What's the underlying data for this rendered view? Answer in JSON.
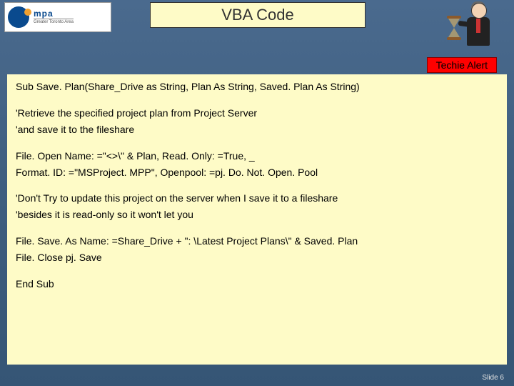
{
  "logo": {
    "mpa": "mpa",
    "sub": "Greater Toronto Area"
  },
  "title": "VBA Code",
  "alert": "Techie Alert",
  "code": {
    "l1": "Sub Save. Plan(Share_Drive as String, Plan As String, Saved. Plan As String)",
    "l2": "'Retrieve the specified project plan from Project Server",
    "l3": "'and save it to the fileshare",
    "l4": "File. Open Name: =\"<>\\\" & Plan, Read. Only: =True, _",
    "l5": "Format. ID: =\"MSProject. MPP\",  Openpool: =pj. Do. Not. Open. Pool",
    "l6": "'Don't Try to update this project on the server when I save it to a fileshare",
    "l7": "'besides it is read-only so it won't let you",
    "l8": "File. Save. As Name: =Share_Drive + \": \\Latest Project Plans\\\" & Saved. Plan",
    "l9": "File. Close pj. Save",
    "l10": "End Sub"
  },
  "footer": "Slide  6"
}
